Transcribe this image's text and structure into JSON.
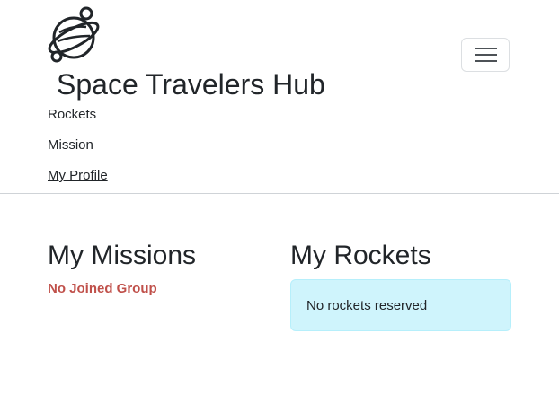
{
  "brand": {
    "title": "Space Travelers Hub",
    "logo_icon": "planet-logo-icon"
  },
  "nav": {
    "toggle_icon": "hamburger-menu-icon",
    "links": [
      {
        "label": "Rockets",
        "active": false
      },
      {
        "label": "Mission",
        "active": false
      },
      {
        "label": "My Profile",
        "active": true
      }
    ]
  },
  "missions": {
    "title": "My Missions",
    "empty_text": "No Joined Group"
  },
  "rockets": {
    "title": "My Rockets",
    "empty_text": "No rockets reserved"
  },
  "colors": {
    "text": "#212529",
    "empty_missions": "#c0504a",
    "alert_bg": "#cff4fc",
    "alert_border": "#b6effb",
    "divider": "#cfd3d7"
  }
}
